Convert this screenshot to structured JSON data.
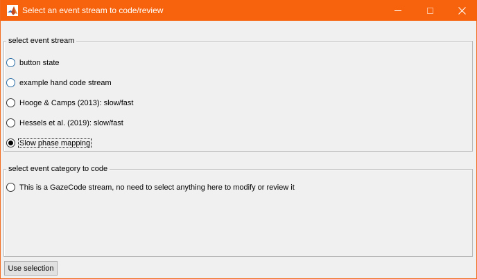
{
  "window": {
    "title": "Select an event stream to code/review",
    "accent_color": "#f7630c",
    "app_icon": "matlab-icon",
    "controls": [
      "minimize-icon",
      "maximize-icon",
      "close-icon"
    ]
  },
  "event_stream_group": {
    "legend": "select event stream",
    "options": [
      {
        "label": "button state",
        "selected": false
      },
      {
        "label": "example hand code stream",
        "selected": false
      },
      {
        "label": "Hooge & Camps (2013): slow/fast",
        "selected": false
      },
      {
        "label": "Hessels et al. (2019): slow/fast",
        "selected": false
      },
      {
        "label": "Slow phase mapping",
        "selected": true
      }
    ]
  },
  "event_category_group": {
    "legend": "select event category to code",
    "options": [
      {
        "label": "This is a GazeCode stream, no need to select anything here to modify or review it",
        "selected": false
      }
    ]
  },
  "footer": {
    "use_selection_label": "Use selection"
  }
}
